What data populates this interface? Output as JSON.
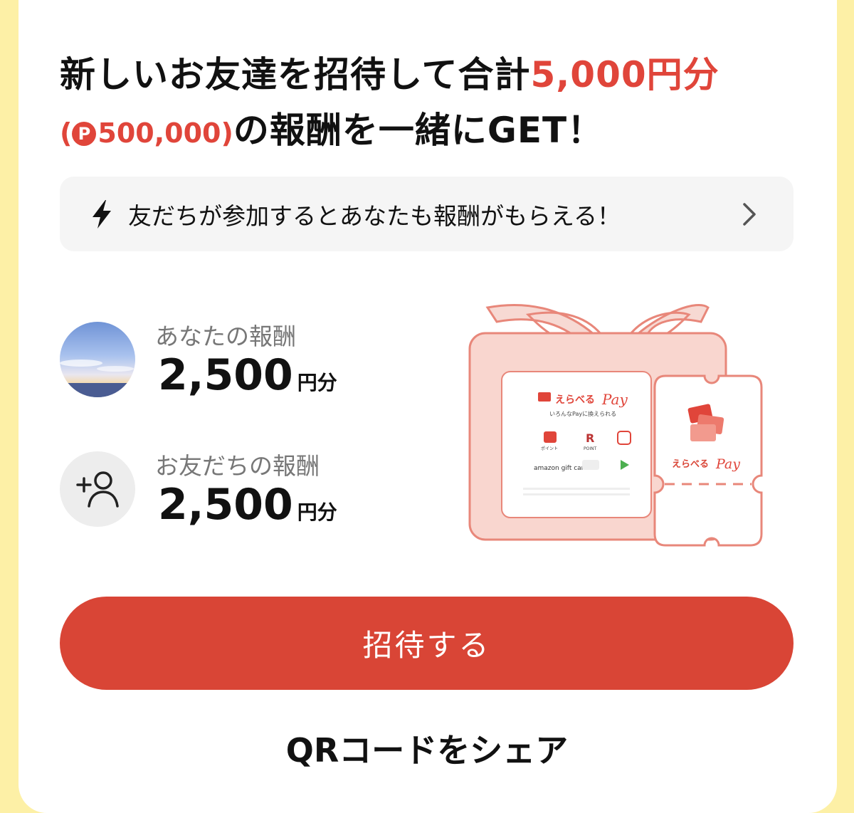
{
  "headline": {
    "part1": "新しいお友達を招待して合計",
    "highlight": "5,000円分",
    "paren_open": "(",
    "point_symbol": "P",
    "point_amount": "500,000",
    "paren_close": ")",
    "part2": "の報酬を一緒にGET！"
  },
  "info_bar": {
    "text": "友だちが参加するとあなたも報酬がもらえる！",
    "icon": "lightning-icon",
    "chevron": "chevron-right-icon"
  },
  "rewards": {
    "you": {
      "label": "あなたの報酬",
      "amount": "2,500",
      "unit": "円分"
    },
    "friend": {
      "label": "お友だちの報酬",
      "amount": "2,500",
      "unit": "円分"
    }
  },
  "gift_card": {
    "brand_small": "えらべる",
    "brand_pay": "Pay",
    "tagline": "いろんなPayに換えられる",
    "ticket_brand": "えらべる",
    "ticket_pay": "Pay",
    "items": [
      "ポイント",
      "POINT",
      "amazon gift card"
    ]
  },
  "actions": {
    "invite": "招待する",
    "qr_share": "QRコードをシェア"
  },
  "colors": {
    "accent": "#E0453A",
    "button": "#D94536",
    "background": "#FDF0A6",
    "gift": "#E8877A"
  }
}
